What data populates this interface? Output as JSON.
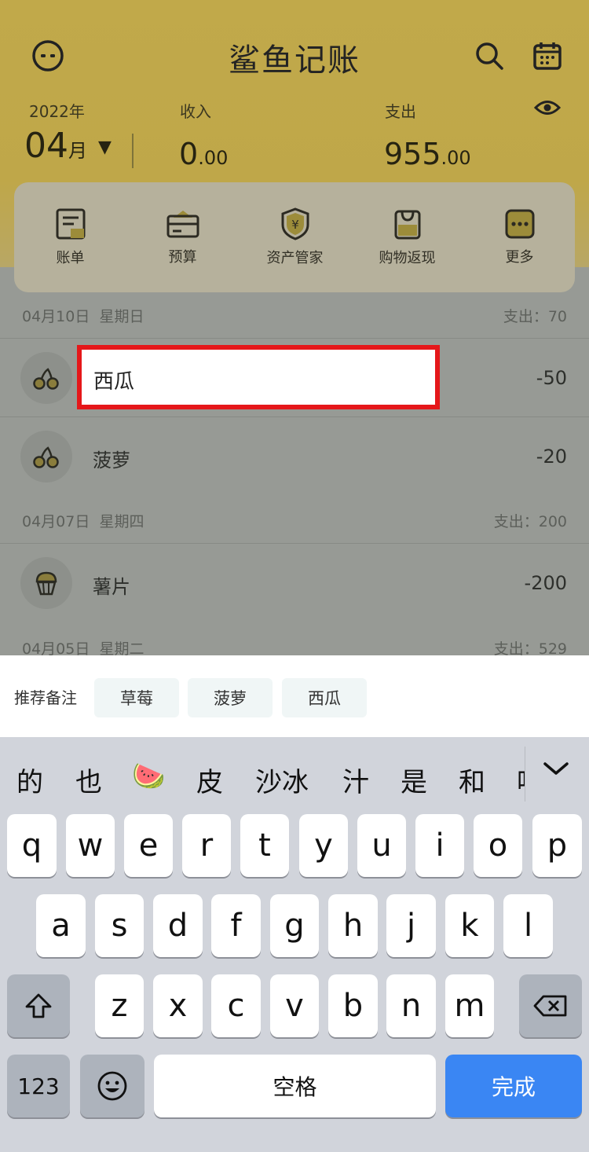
{
  "header": {
    "title": "鲨鱼记账",
    "year": "2022年",
    "month_num": "04",
    "month_suffix": "月",
    "month_caret": "▼",
    "income_label": "收入",
    "income_int": "0",
    "income_dec": ".00",
    "expense_label": "支出",
    "expense_int": "955",
    "expense_dec": ".00"
  },
  "menu": [
    {
      "label": "账单",
      "icon": "bill-icon"
    },
    {
      "label": "预算",
      "icon": "budget-icon"
    },
    {
      "label": "资产管家",
      "icon": "asset-shield-icon"
    },
    {
      "label": "购物返现",
      "icon": "shopping-bag-icon"
    },
    {
      "label": "更多",
      "icon": "more-dots-icon"
    }
  ],
  "days": [
    {
      "date": "04月10日",
      "weekday": "星期日",
      "total": "支出：70"
    },
    {
      "date": "04月07日",
      "weekday": "星期四",
      "total": "支出：200"
    },
    {
      "date": "04月05日",
      "weekday": "星期二",
      "total": "支出：529"
    }
  ],
  "transactions": [
    {
      "name": "西瓜",
      "amount": "-50",
      "icon": "fruit-cherry-icon"
    },
    {
      "name": "菠萝",
      "amount": "-20",
      "icon": "fruit-cherry-icon"
    },
    {
      "name": "薯片",
      "amount": "-200",
      "icon": "snack-muffin-icon"
    }
  ],
  "remark_input": {
    "value": "西瓜"
  },
  "suggestions": {
    "label": "推荐备注",
    "chips": [
      "草莓",
      "菠萝",
      "西瓜"
    ]
  },
  "keyboard": {
    "candidates": [
      "的",
      "也",
      "🍉",
      "皮",
      "沙冰",
      "汁",
      "是",
      "和",
      "喝"
    ],
    "row1": [
      "q",
      "w",
      "e",
      "r",
      "t",
      "y",
      "u",
      "i",
      "o",
      "p"
    ],
    "row2": [
      "a",
      "s",
      "d",
      "f",
      "g",
      "h",
      "j",
      "k",
      "l"
    ],
    "row3": [
      "z",
      "x",
      "c",
      "v",
      "b",
      "n",
      "m"
    ],
    "numbers_key": "123",
    "space_key": "空格",
    "done_key": "完成"
  }
}
